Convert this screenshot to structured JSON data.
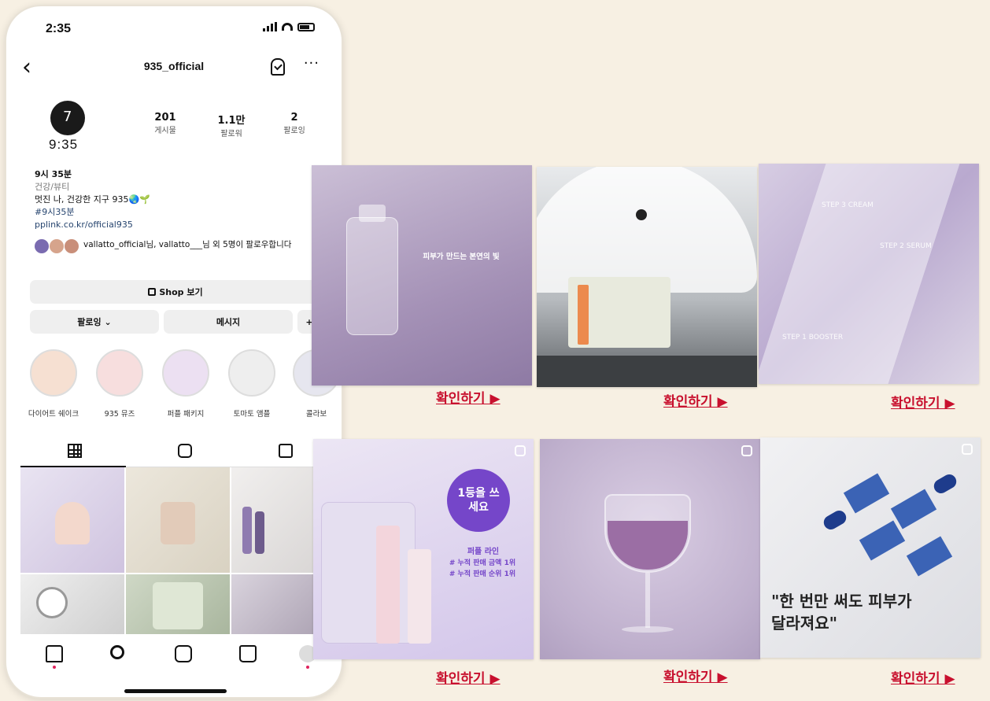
{
  "status_bar": {
    "time": "2:35"
  },
  "profile": {
    "username": "935_official",
    "avatar_label": "9:35",
    "stats": [
      {
        "num": "201",
        "label": "게시물"
      },
      {
        "num": "1.1만",
        "label": "팔로워"
      },
      {
        "num": "2",
        "label": "팔로잉"
      }
    ],
    "bio": {
      "name": "9시 35분",
      "category": "건강/뷰티",
      "text": "멋진 나, 건강한 지구 935🌏🌱",
      "hashtag": "#9시35분",
      "link": "pplink.co.kr/official935"
    },
    "followed_by": "vallatto_official님, vallatto___님 외 5명이 팔로우합니다"
  },
  "buttons": {
    "shop": "Shop 보기",
    "following": "팔로잉 ⌄",
    "message": "메시지",
    "add": "+"
  },
  "highlights": [
    {
      "label": "다이어트 쉐이크",
      "color": "#f6e0d2"
    },
    {
      "label": "935 뮤즈",
      "color": "#f7dede"
    },
    {
      "label": "퍼플 패키지",
      "color": "#ece0f2"
    },
    {
      "label": "토마토 앰플",
      "color": "#eeeeee"
    },
    {
      "label": "콜라보",
      "color": "#e6e6ef"
    }
  ],
  "promo_tiles": [
    {
      "caption": "피부가 만드는 본연의 빛",
      "cta": "확인하기 ▶",
      "color": "#b8a6c6"
    },
    {
      "caption": "",
      "cta": "확인하기 ▶",
      "color": "#9aa0a6"
    },
    {
      "caption_steps": [
        "STEP 3 CREAM",
        "STEP 2 SERUM",
        "STEP 1 BOOSTER"
      ],
      "cta": "확인하기 ▶",
      "color": "#c9bcd9"
    },
    {
      "badge": "1등을 쓰세요",
      "caption": "퍼플 라인",
      "lines": [
        "# 누적 판매 금액 1위",
        "# 누적 판매 순위 1위"
      ],
      "cta": "확인하기 ▶",
      "color": "#d7ccec"
    },
    {
      "caption": "",
      "cta": "확인하기 ▶",
      "color": "#cbbcd8"
    },
    {
      "headline": "\"한 번만 써도 피부가 달라져요\"",
      "highlight": "한 번만",
      "cta": "확인하기 ▶",
      "color": "#e9eaee"
    }
  ]
}
